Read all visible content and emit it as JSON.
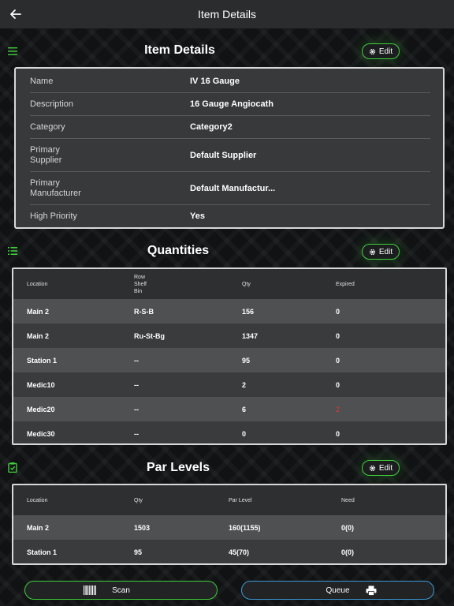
{
  "header": {
    "title": "Item Details",
    "back_icon": "arrow-left-icon"
  },
  "details": {
    "title": "Item Details",
    "edit_label": "Edit",
    "rows": [
      {
        "label": "Name",
        "value": "IV 16 Gauge"
      },
      {
        "label": "Description",
        "value": "16 Gauge Angiocath"
      },
      {
        "label": "Category",
        "value": "Category2"
      },
      {
        "label": "Primary\nSupplier",
        "value": "Default Supplier"
      },
      {
        "label": "Primary\nManufacturer",
        "value": "Default Manufactur..."
      },
      {
        "label": "High Priority",
        "value": "Yes"
      }
    ]
  },
  "quantities": {
    "title": "Quantities",
    "edit_label": "Edit",
    "headers": {
      "location": "Location",
      "rsb": "Row\nShelf\nBin",
      "qty": "Qty",
      "expired": "Expired"
    },
    "rows": [
      {
        "location": "Main 2",
        "rsb": "R-S-B",
        "qty": "156",
        "expired": "0",
        "expired_alert": false
      },
      {
        "location": "Main 2",
        "rsb": "Ru-St-Bg",
        "qty": "1347",
        "expired": "0",
        "expired_alert": false
      },
      {
        "location": "Station 1",
        "rsb": "--",
        "qty": "95",
        "expired": "0",
        "expired_alert": false
      },
      {
        "location": "Medic10",
        "rsb": "--",
        "qty": "2",
        "expired": "0",
        "expired_alert": false
      },
      {
        "location": "Medic20",
        "rsb": "--",
        "qty": "6",
        "expired": "2",
        "expired_alert": true
      },
      {
        "location": "Medic30",
        "rsb": "--",
        "qty": "0",
        "expired": "0",
        "expired_alert": false
      }
    ]
  },
  "par_levels": {
    "title": "Par Levels",
    "edit_label": "Edit",
    "headers": {
      "location": "Location",
      "qty": "Qty",
      "par": "Par Level",
      "need": "Need"
    },
    "rows": [
      {
        "location": "Main 2",
        "qty": "1503",
        "par": "160(1155)",
        "need": "0(0)"
      },
      {
        "location": "Station 1",
        "qty": "95",
        "par": "45(70)",
        "need": "0(0)"
      }
    ]
  },
  "actions": {
    "scan_label": "Scan",
    "queue_label": "Queue"
  },
  "colors": {
    "accent_green": "#3fcf3a",
    "accent_blue": "#3d9ad8",
    "alert_red": "#d63b3b"
  }
}
